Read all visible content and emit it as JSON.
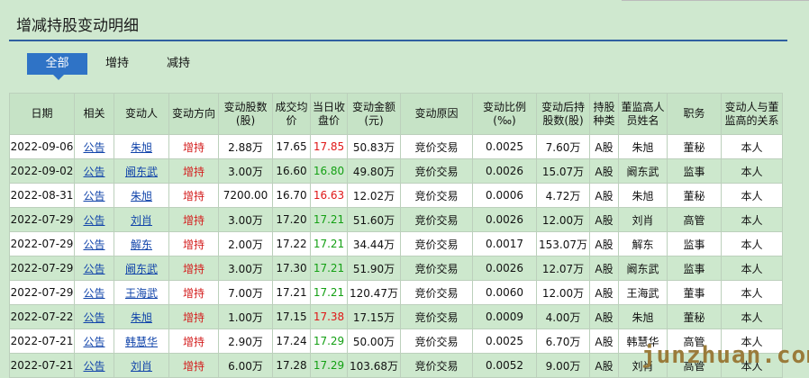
{
  "page_title": "增减持股变动明细",
  "tabs": [
    {
      "label": "全部",
      "active": true
    },
    {
      "label": "增持",
      "active": false
    },
    {
      "label": "减持",
      "active": false
    }
  ],
  "columns": [
    "日期",
    "相关",
    "变动人",
    "变动方向",
    "变动股数(股)",
    "成交均价",
    "当日收盘价",
    "变动金额(元)",
    "变动原因",
    "变动比例(‰)",
    "变动后持股数(股)",
    "持股种类",
    "董监高人员姓名",
    "职务",
    "变动人与董监高的关系"
  ],
  "rows": [
    {
      "date": "2022-09-06",
      "link": "公告",
      "person": "朱旭",
      "dir": "增持",
      "shares": "2.88万",
      "avg": "17.65",
      "close": "17.85",
      "close_color": "red",
      "amount": "50.83万",
      "reason": "竞价交易",
      "ratio": "0.0025",
      "after": "7.60万",
      "kind": "A股",
      "exec": "朱旭",
      "role": "董秘",
      "rel": "本人"
    },
    {
      "date": "2022-09-02",
      "link": "公告",
      "person": "阚东武",
      "dir": "增持",
      "shares": "3.00万",
      "avg": "16.60",
      "close": "16.80",
      "close_color": "green",
      "amount": "49.80万",
      "reason": "竞价交易",
      "ratio": "0.0026",
      "after": "15.07万",
      "kind": "A股",
      "exec": "阚东武",
      "role": "监事",
      "rel": "本人"
    },
    {
      "date": "2022-08-31",
      "link": "公告",
      "person": "朱旭",
      "dir": "增持",
      "shares": "7200.00",
      "avg": "16.70",
      "close": "16.63",
      "close_color": "red",
      "amount": "12.02万",
      "reason": "竞价交易",
      "ratio": "0.0006",
      "after": "4.72万",
      "kind": "A股",
      "exec": "朱旭",
      "role": "董秘",
      "rel": "本人"
    },
    {
      "date": "2022-07-29",
      "link": "公告",
      "person": "刘肖",
      "dir": "增持",
      "shares": "3.00万",
      "avg": "17.20",
      "close": "17.21",
      "close_color": "green",
      "amount": "51.60万",
      "reason": "竞价交易",
      "ratio": "0.0026",
      "after": "12.00万",
      "kind": "A股",
      "exec": "刘肖",
      "role": "高管",
      "rel": "本人"
    },
    {
      "date": "2022-07-29",
      "link": "公告",
      "person": "解东",
      "dir": "增持",
      "shares": "2.00万",
      "avg": "17.22",
      "close": "17.21",
      "close_color": "green",
      "amount": "34.44万",
      "reason": "竞价交易",
      "ratio": "0.0017",
      "after": "153.07万",
      "kind": "A股",
      "exec": "解东",
      "role": "监事",
      "rel": "本人"
    },
    {
      "date": "2022-07-29",
      "link": "公告",
      "person": "阚东武",
      "dir": "增持",
      "shares": "3.00万",
      "avg": "17.30",
      "close": "17.21",
      "close_color": "green",
      "amount": "51.90万",
      "reason": "竞价交易",
      "ratio": "0.0026",
      "after": "12.07万",
      "kind": "A股",
      "exec": "阚东武",
      "role": "监事",
      "rel": "本人"
    },
    {
      "date": "2022-07-29",
      "link": "公告",
      "person": "王海武",
      "dir": "增持",
      "shares": "7.00万",
      "avg": "17.21",
      "close": "17.21",
      "close_color": "green",
      "amount": "120.47万",
      "reason": "竞价交易",
      "ratio": "0.0060",
      "after": "12.00万",
      "kind": "A股",
      "exec": "王海武",
      "role": "董事",
      "rel": "本人"
    },
    {
      "date": "2022-07-22",
      "link": "公告",
      "person": "朱旭",
      "dir": "增持",
      "shares": "1.00万",
      "avg": "17.15",
      "close": "17.38",
      "close_color": "red",
      "amount": "17.15万",
      "reason": "竞价交易",
      "ratio": "0.0009",
      "after": "4.00万",
      "kind": "A股",
      "exec": "朱旭",
      "role": "董秘",
      "rel": "本人"
    },
    {
      "date": "2022-07-21",
      "link": "公告",
      "person": "韩慧华",
      "dir": "增持",
      "shares": "2.90万",
      "avg": "17.24",
      "close": "17.29",
      "close_color": "green",
      "amount": "50.00万",
      "reason": "竞价交易",
      "ratio": "0.0025",
      "after": "6.70万",
      "kind": "A股",
      "exec": "韩慧华",
      "role": "高管",
      "rel": "本人"
    },
    {
      "date": "2022-07-21",
      "link": "公告",
      "person": "刘肖",
      "dir": "增持",
      "shares": "6.00万",
      "avg": "17.28",
      "close": "17.29",
      "close_color": "green",
      "amount": "103.68万",
      "reason": "竞价交易",
      "ratio": "0.0052",
      "after": "9.00万",
      "kind": "A股",
      "exec": "刘肖",
      "role": "高管",
      "rel": "本人"
    }
  ],
  "watermark": "junzhuan.com",
  "colors": {
    "accent": "#2f73c6",
    "rule": "#2f5fa0",
    "direction": "#d42020",
    "up": "#e01818",
    "down": "#14a014",
    "background": "#cfe8cf"
  }
}
